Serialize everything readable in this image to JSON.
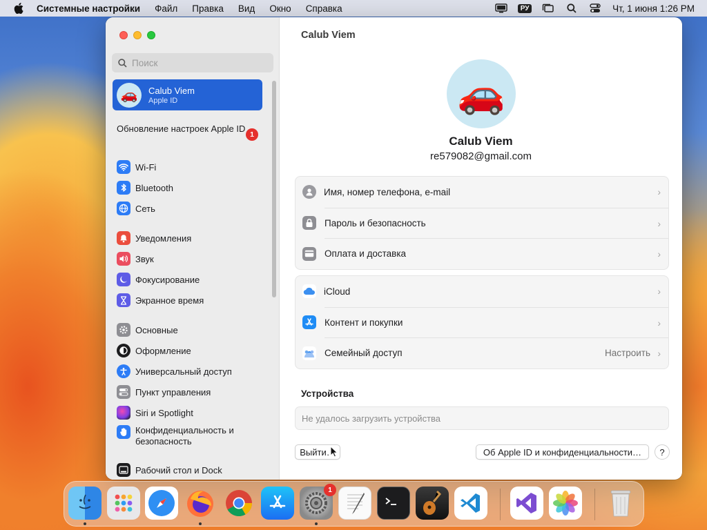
{
  "menubar": {
    "app_name": "Системные настройки",
    "menus": [
      "Файл",
      "Правка",
      "Вид",
      "Окно",
      "Справка"
    ],
    "input_source": "РУ",
    "clock": "Чт, 1 июня  1:26 PM"
  },
  "sidebar": {
    "search_placeholder": "Поиск",
    "account": {
      "name": "Calub Viem",
      "sub": "Apple ID",
      "avatar": "🚗"
    },
    "update": {
      "label": "Обновление настроек Apple ID",
      "badge": "1"
    },
    "items": [
      {
        "label": "Wi-Fi",
        "icon": "wifi-icon",
        "color": "#2d7cf6"
      },
      {
        "label": "Bluetooth",
        "icon": "bluetooth-icon",
        "color": "#2d7cf6"
      },
      {
        "label": "Сеть",
        "icon": "globe-icon",
        "color": "#2d7cf6"
      },
      {
        "label": "Уведомления",
        "icon": "bell-icon",
        "color": "#eb4d3d"
      },
      {
        "label": "Звук",
        "icon": "speaker-icon",
        "color": "#eb4d5f"
      },
      {
        "label": "Фокусирование",
        "icon": "moon-icon",
        "color": "#5e5ce6"
      },
      {
        "label": "Экранное время",
        "icon": "hourglass-icon",
        "color": "#5e5ce6"
      },
      {
        "label": "Основные",
        "icon": "gear-icon",
        "color": "#8e8e93"
      },
      {
        "label": "Оформление",
        "icon": "appearance-icon",
        "color": "#1c1c1e"
      },
      {
        "label": "Универсальный доступ",
        "icon": "accessibility-icon",
        "color": "#2d7cf6"
      },
      {
        "label": "Пункт управления",
        "icon": "toggles-icon",
        "color": "#8e8e93"
      },
      {
        "label": "Siri и Spotlight",
        "icon": "siri-icon",
        "color": "#9b3fd6"
      },
      {
        "label": "Конфиденциальность и безопасность",
        "icon": "hand-icon",
        "color": "#2d7cf6"
      },
      {
        "label": "Рабочий стол и Dock",
        "icon": "dock-icon",
        "color": "#1c1c1e"
      }
    ]
  },
  "content": {
    "title": "Calub Viem",
    "avatar": "🚗",
    "name": "Calub Viem",
    "email": "re579082@gmail.com",
    "group1": [
      {
        "label": "Имя, номер телефона, e-mail",
        "icon": "person-icon"
      },
      {
        "label": "Пароль и безопасность",
        "icon": "lock-icon"
      },
      {
        "label": "Оплата и доставка",
        "icon": "card-icon"
      }
    ],
    "group2": [
      {
        "label": "iCloud",
        "icon": "cloud-icon"
      },
      {
        "label": "Контент и покупки",
        "icon": "appstore-icon"
      },
      {
        "label": "Семейный доступ",
        "icon": "family-icon",
        "value": "Настроить"
      }
    ],
    "devices_header": "Устройства",
    "devices_status": "Не удалось загрузить устройства",
    "signout_label": "Выйти…",
    "about_label": "Об Apple ID и конфиденциальности…",
    "help_label": "?"
  },
  "dock": {
    "settings_badge": "1"
  }
}
